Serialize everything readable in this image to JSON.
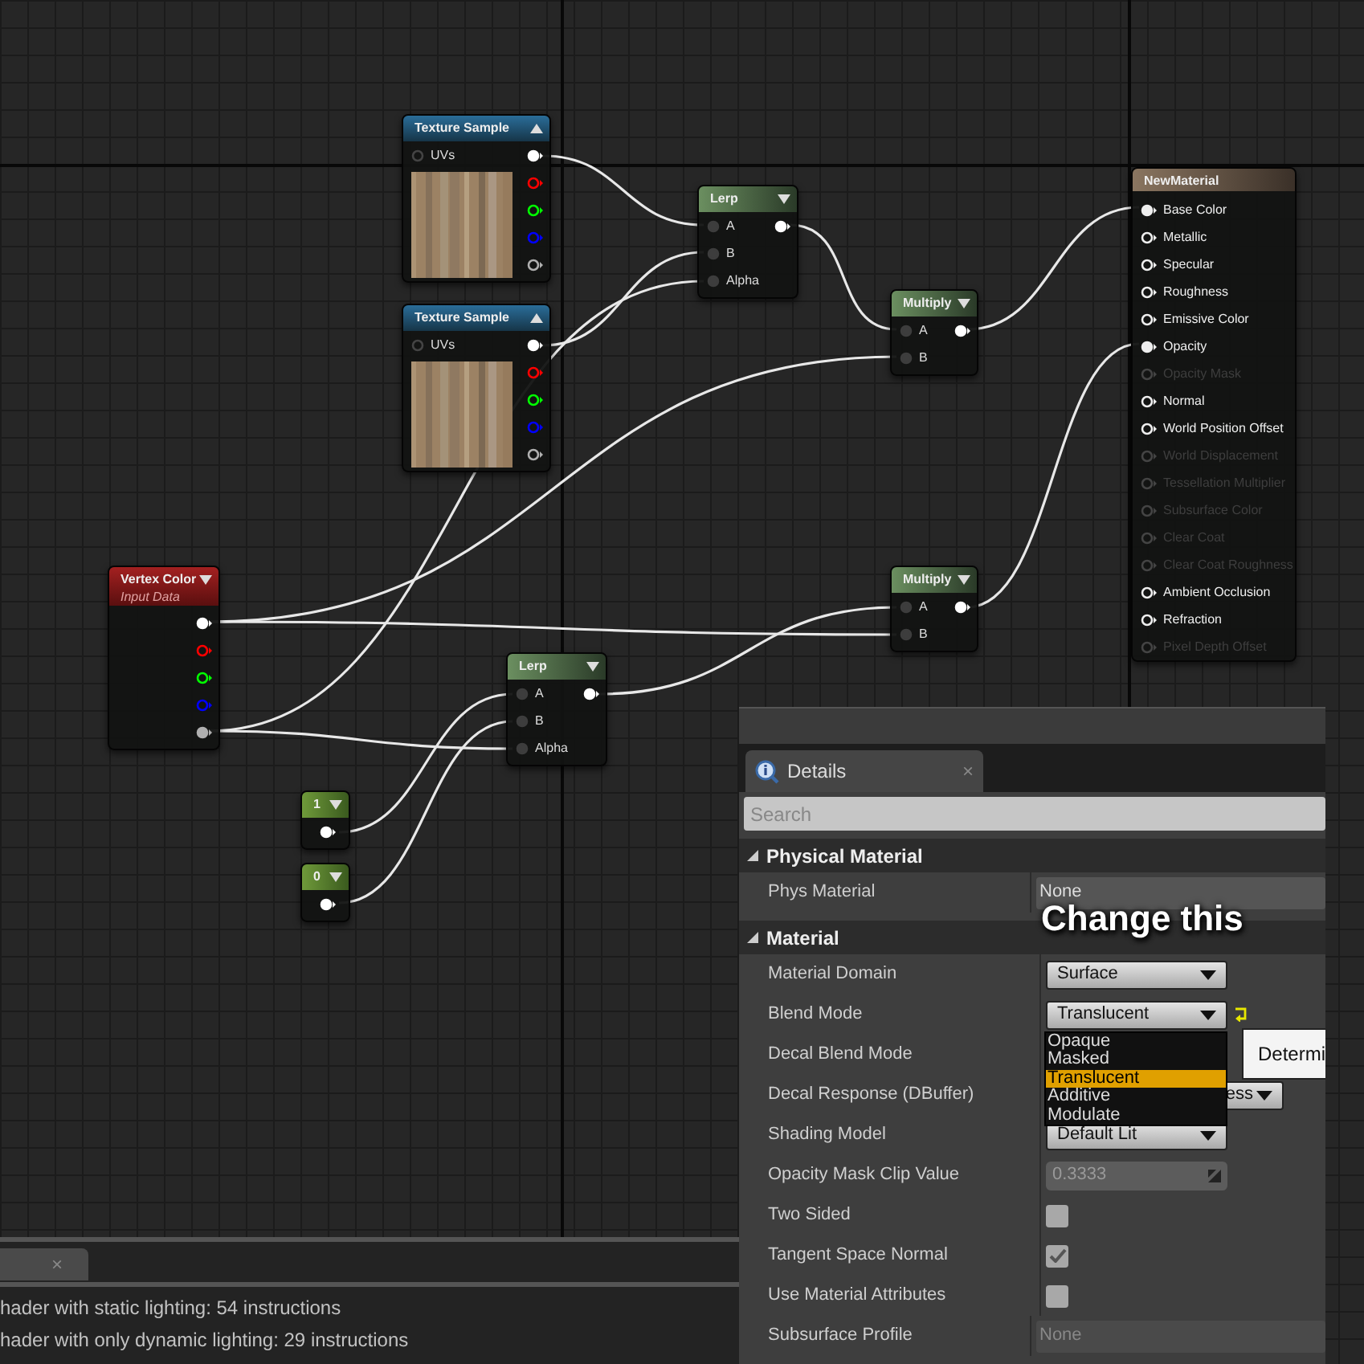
{
  "nodes": [
    {
      "kind": "texture",
      "title": "Texture Sample",
      "expanded": true,
      "inputs": [
        {
          "label": "UVs"
        }
      ],
      "outputs": [
        {
          "color": "#ffffff",
          "connected": true
        },
        {
          "color": "#ff0000",
          "connected": false
        },
        {
          "color": "#00ff00",
          "connected": false
        },
        {
          "color": "#0000ff",
          "connected": false
        },
        {
          "color": "#b0b0b0",
          "connected": false
        }
      ]
    },
    {
      "kind": "texture",
      "title": "Texture Sample",
      "expanded": true,
      "inputs": [
        {
          "label": "UVs"
        }
      ],
      "outputs": [
        {
          "color": "#ffffff",
          "connected": true
        },
        {
          "color": "#ff0000",
          "connected": false
        },
        {
          "color": "#00ff00",
          "connected": false
        },
        {
          "color": "#0000ff",
          "connected": false
        },
        {
          "color": "#b0b0b0",
          "connected": false
        }
      ]
    },
    {
      "kind": "math",
      "title": "Lerp",
      "expanded": false,
      "inputs": [
        {
          "label": "A"
        },
        {
          "label": "B"
        },
        {
          "label": "Alpha"
        }
      ],
      "outputs": [
        {
          "color": "#ffffff",
          "connected": true
        }
      ]
    },
    {
      "kind": "math",
      "title": "Multiply",
      "expanded": false,
      "inputs": [
        {
          "label": "A"
        },
        {
          "label": "B"
        }
      ],
      "outputs": [
        {
          "color": "#ffffff",
          "connected": true
        }
      ]
    },
    {
      "kind": "material",
      "title": "NewMaterial",
      "inputs": [
        {
          "label": "Base Color",
          "connected": true,
          "disabled": false
        },
        {
          "label": "Metallic",
          "connected": false,
          "disabled": false
        },
        {
          "label": "Specular",
          "connected": false,
          "disabled": false
        },
        {
          "label": "Roughness",
          "connected": false,
          "disabled": false
        },
        {
          "label": "Emissive Color",
          "connected": false,
          "disabled": false
        },
        {
          "label": "Opacity",
          "connected": true,
          "disabled": false
        },
        {
          "label": "Opacity Mask",
          "connected": false,
          "disabled": true
        },
        {
          "label": "Normal",
          "connected": false,
          "disabled": false
        },
        {
          "label": "World Position Offset",
          "connected": false,
          "disabled": false
        },
        {
          "label": "World Displacement",
          "connected": false,
          "disabled": true
        },
        {
          "label": "Tessellation Multiplier",
          "connected": false,
          "disabled": true
        },
        {
          "label": "Subsurface Color",
          "connected": false,
          "disabled": true
        },
        {
          "label": "Clear Coat",
          "connected": false,
          "disabled": true
        },
        {
          "label": "Clear Coat Roughness",
          "connected": false,
          "disabled": true
        },
        {
          "label": "Ambient Occlusion",
          "connected": false,
          "disabled": false
        },
        {
          "label": "Refraction",
          "connected": false,
          "disabled": false
        },
        {
          "label": "Pixel Depth Offset",
          "connected": false,
          "disabled": true
        }
      ]
    },
    {
      "kind": "input",
      "title": "Vertex Color",
      "subtitle": "Input Data",
      "expanded": false,
      "outputs": [
        {
          "color": "#ffffff",
          "connected": true
        },
        {
          "color": "#ff0000",
          "connected": false
        },
        {
          "color": "#00ff00",
          "connected": false
        },
        {
          "color": "#0000ff",
          "connected": false
        },
        {
          "color": "#b0b0b0",
          "connected": true
        }
      ]
    },
    {
      "kind": "math",
      "title": "Multiply",
      "expanded": false,
      "inputs": [
        {
          "label": "A"
        },
        {
          "label": "B"
        }
      ],
      "outputs": [
        {
          "color": "#ffffff",
          "connected": true
        }
      ]
    },
    {
      "kind": "math",
      "title": "Lerp",
      "expanded": false,
      "inputs": [
        {
          "label": "A"
        },
        {
          "label": "B"
        },
        {
          "label": "Alpha"
        }
      ],
      "outputs": [
        {
          "color": "#ffffff",
          "connected": true
        }
      ]
    },
    {
      "kind": "constant",
      "title": "1",
      "expanded": false,
      "outputs": [
        {
          "color": "#ffffff",
          "connected": true
        }
      ]
    },
    {
      "kind": "constant",
      "title": "0",
      "expanded": false,
      "outputs": [
        {
          "color": "#ffffff",
          "connected": true
        }
      ]
    }
  ],
  "details": {
    "tab": "Details",
    "close": "×",
    "search_placeholder": "Search",
    "sections": [
      {
        "title": "Physical Material",
        "expanded": true,
        "rows": [
          {
            "kind": "asset",
            "label": "Phys Material",
            "value": "None",
            "disabled": false
          }
        ]
      },
      {
        "title": "Material",
        "expanded": true,
        "rows": [
          {
            "kind": "dropdown",
            "label": "Material Domain",
            "value": "Surface"
          },
          {
            "kind": "dropdown",
            "label": "Blend Mode",
            "value": "Translucent",
            "modified": true,
            "open": true,
            "options": [
              {
                "label": "Opaque",
                "selected": false
              },
              {
                "label": "Masked",
                "selected": false
              },
              {
                "label": "Translucent",
                "selected": true
              },
              {
                "label": "Additive",
                "selected": false
              },
              {
                "label": "Modulate",
                "selected": false
              }
            ]
          },
          {
            "label": "Decal Blend Mode"
          },
          {
            "kind": "dropdown_wide",
            "label": "Decal Response (DBuffer)",
            "value": "ess"
          },
          {
            "kind": "dropdown",
            "label": "Shading Model",
            "value": "Default Lit"
          },
          {
            "kind": "number",
            "label": "Opacity Mask Clip Value",
            "value": "0.3333"
          },
          {
            "kind": "checkbox",
            "label": "Two Sided",
            "checked": false
          },
          {
            "kind": "checkbox",
            "label": "Tangent Space Normal",
            "checked": true
          },
          {
            "kind": "checkbox",
            "label": "Use Material Attributes",
            "checked": false
          },
          {
            "kind": "asset",
            "label": "Subsurface Profile",
            "value": "None",
            "disabled": true
          }
        ]
      }
    ],
    "tooltip": "Determi",
    "annotation": "Change this"
  },
  "stats": {
    "tab_close": "×",
    "lines": [
      "hader with static lighting: 54 instructions",
      "hader with only dynamic lighting: 29 instructions"
    ]
  }
}
